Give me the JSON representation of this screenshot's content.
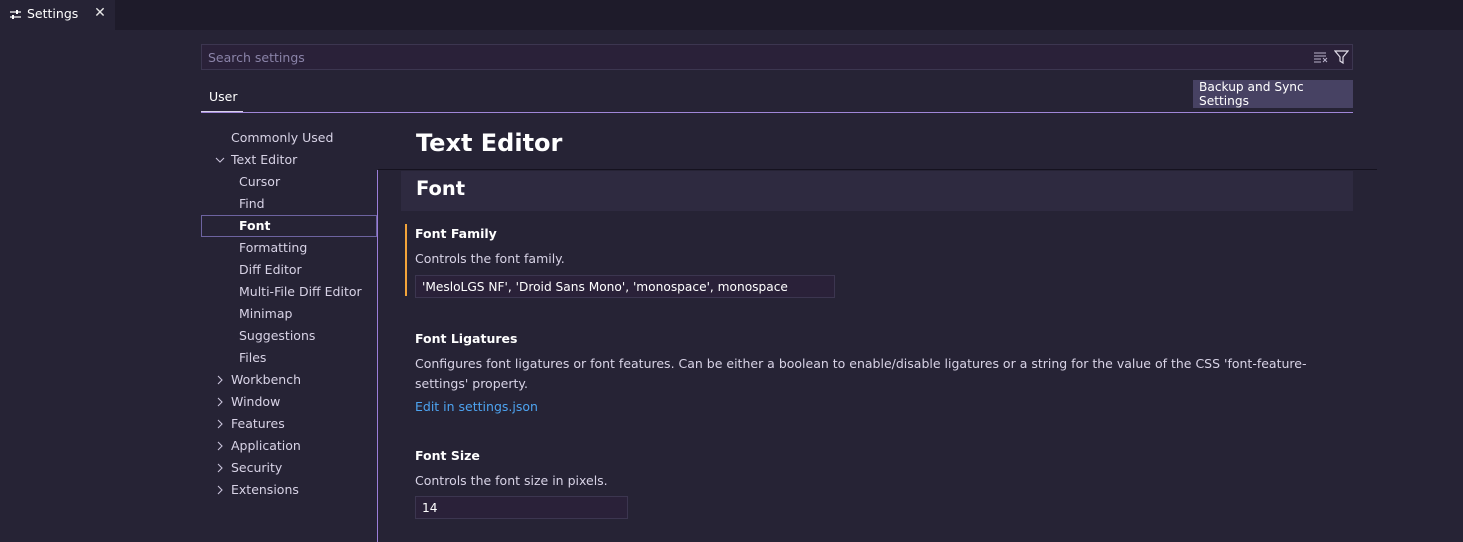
{
  "tab": {
    "label": "Settings",
    "icon": "settings-sliders-icon",
    "close_icon": "close-icon"
  },
  "search": {
    "placeholder": "Search settings",
    "value": ""
  },
  "scope": {
    "user_tab": "User",
    "sync_button": "Backup and Sync Settings"
  },
  "toc": {
    "items": [
      {
        "label": "Commonly Used",
        "level": 0,
        "chevron": "none"
      },
      {
        "label": "Text Editor",
        "level": 0,
        "chevron": "chevron-down-icon"
      },
      {
        "label": "Cursor",
        "level": 1,
        "chevron": "none"
      },
      {
        "label": "Find",
        "level": 1,
        "chevron": "none"
      },
      {
        "label": "Font",
        "level": 1,
        "chevron": "none",
        "selected": true
      },
      {
        "label": "Formatting",
        "level": 1,
        "chevron": "none"
      },
      {
        "label": "Diff Editor",
        "level": 1,
        "chevron": "none"
      },
      {
        "label": "Multi-File Diff Editor",
        "level": 1,
        "chevron": "none"
      },
      {
        "label": "Minimap",
        "level": 1,
        "chevron": "none"
      },
      {
        "label": "Suggestions",
        "level": 1,
        "chevron": "none"
      },
      {
        "label": "Files",
        "level": 1,
        "chevron": "none"
      },
      {
        "label": "Workbench",
        "level": 0,
        "chevron": "chevron-right-icon"
      },
      {
        "label": "Window",
        "level": 0,
        "chevron": "chevron-right-icon"
      },
      {
        "label": "Features",
        "level": 0,
        "chevron": "chevron-right-icon"
      },
      {
        "label": "Application",
        "level": 0,
        "chevron": "chevron-right-icon"
      },
      {
        "label": "Security",
        "level": 0,
        "chevron": "chevron-right-icon"
      },
      {
        "label": "Extensions",
        "level": 0,
        "chevron": "chevron-right-icon"
      }
    ]
  },
  "content": {
    "title": "Text Editor",
    "section": "Font",
    "settings": {
      "font_family": {
        "title": "Font Family",
        "description": "Controls the font family.",
        "value": "'MesloLGS NF', 'Droid Sans Mono', 'monospace', monospace"
      },
      "font_ligatures": {
        "title": "Font Ligatures",
        "description": "Configures font ligatures or font features. Can be either a boolean to enable/disable ligatures or a string for the value of the CSS 'font-feature-settings' property.",
        "link": "Edit in settings.json"
      },
      "font_size": {
        "title": "Font Size",
        "description": "Controls the font size in pixels.",
        "value": "14"
      }
    }
  },
  "colors": {
    "background": "#262335",
    "accent_line": "#a086d8",
    "modified_marker": "#f3a43a",
    "link": "#4da3f0"
  }
}
